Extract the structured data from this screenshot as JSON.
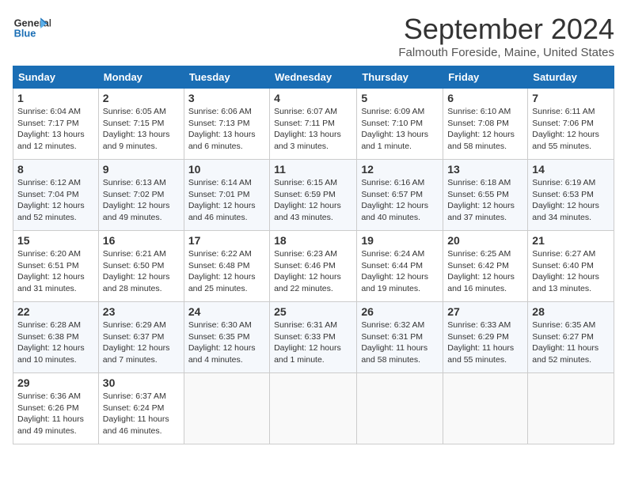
{
  "header": {
    "logo_general": "General",
    "logo_blue": "Blue",
    "month": "September 2024",
    "location": "Falmouth Foreside, Maine, United States"
  },
  "weekdays": [
    "Sunday",
    "Monday",
    "Tuesday",
    "Wednesday",
    "Thursday",
    "Friday",
    "Saturday"
  ],
  "weeks": [
    [
      {
        "day": "1",
        "sunrise": "6:04 AM",
        "sunset": "7:17 PM",
        "daylight": "13 hours and 12 minutes."
      },
      {
        "day": "2",
        "sunrise": "6:05 AM",
        "sunset": "7:15 PM",
        "daylight": "13 hours and 9 minutes."
      },
      {
        "day": "3",
        "sunrise": "6:06 AM",
        "sunset": "7:13 PM",
        "daylight": "13 hours and 6 minutes."
      },
      {
        "day": "4",
        "sunrise": "6:07 AM",
        "sunset": "7:11 PM",
        "daylight": "13 hours and 3 minutes."
      },
      {
        "day": "5",
        "sunrise": "6:09 AM",
        "sunset": "7:10 PM",
        "daylight": "13 hours and 1 minute."
      },
      {
        "day": "6",
        "sunrise": "6:10 AM",
        "sunset": "7:08 PM",
        "daylight": "12 hours and 58 minutes."
      },
      {
        "day": "7",
        "sunrise": "6:11 AM",
        "sunset": "7:06 PM",
        "daylight": "12 hours and 55 minutes."
      }
    ],
    [
      {
        "day": "8",
        "sunrise": "6:12 AM",
        "sunset": "7:04 PM",
        "daylight": "12 hours and 52 minutes."
      },
      {
        "day": "9",
        "sunrise": "6:13 AM",
        "sunset": "7:02 PM",
        "daylight": "12 hours and 49 minutes."
      },
      {
        "day": "10",
        "sunrise": "6:14 AM",
        "sunset": "7:01 PM",
        "daylight": "12 hours and 46 minutes."
      },
      {
        "day": "11",
        "sunrise": "6:15 AM",
        "sunset": "6:59 PM",
        "daylight": "12 hours and 43 minutes."
      },
      {
        "day": "12",
        "sunrise": "6:16 AM",
        "sunset": "6:57 PM",
        "daylight": "12 hours and 40 minutes."
      },
      {
        "day": "13",
        "sunrise": "6:18 AM",
        "sunset": "6:55 PM",
        "daylight": "12 hours and 37 minutes."
      },
      {
        "day": "14",
        "sunrise": "6:19 AM",
        "sunset": "6:53 PM",
        "daylight": "12 hours and 34 minutes."
      }
    ],
    [
      {
        "day": "15",
        "sunrise": "6:20 AM",
        "sunset": "6:51 PM",
        "daylight": "12 hours and 31 minutes."
      },
      {
        "day": "16",
        "sunrise": "6:21 AM",
        "sunset": "6:50 PM",
        "daylight": "12 hours and 28 minutes."
      },
      {
        "day": "17",
        "sunrise": "6:22 AM",
        "sunset": "6:48 PM",
        "daylight": "12 hours and 25 minutes."
      },
      {
        "day": "18",
        "sunrise": "6:23 AM",
        "sunset": "6:46 PM",
        "daylight": "12 hours and 22 minutes."
      },
      {
        "day": "19",
        "sunrise": "6:24 AM",
        "sunset": "6:44 PM",
        "daylight": "12 hours and 19 minutes."
      },
      {
        "day": "20",
        "sunrise": "6:25 AM",
        "sunset": "6:42 PM",
        "daylight": "12 hours and 16 minutes."
      },
      {
        "day": "21",
        "sunrise": "6:27 AM",
        "sunset": "6:40 PM",
        "daylight": "12 hours and 13 minutes."
      }
    ],
    [
      {
        "day": "22",
        "sunrise": "6:28 AM",
        "sunset": "6:38 PM",
        "daylight": "12 hours and 10 minutes."
      },
      {
        "day": "23",
        "sunrise": "6:29 AM",
        "sunset": "6:37 PM",
        "daylight": "12 hours and 7 minutes."
      },
      {
        "day": "24",
        "sunrise": "6:30 AM",
        "sunset": "6:35 PM",
        "daylight": "12 hours and 4 minutes."
      },
      {
        "day": "25",
        "sunrise": "6:31 AM",
        "sunset": "6:33 PM",
        "daylight": "12 hours and 1 minute."
      },
      {
        "day": "26",
        "sunrise": "6:32 AM",
        "sunset": "6:31 PM",
        "daylight": "11 hours and 58 minutes."
      },
      {
        "day": "27",
        "sunrise": "6:33 AM",
        "sunset": "6:29 PM",
        "daylight": "11 hours and 55 minutes."
      },
      {
        "day": "28",
        "sunrise": "6:35 AM",
        "sunset": "6:27 PM",
        "daylight": "11 hours and 52 minutes."
      }
    ],
    [
      {
        "day": "29",
        "sunrise": "6:36 AM",
        "sunset": "6:26 PM",
        "daylight": "11 hours and 49 minutes."
      },
      {
        "day": "30",
        "sunrise": "6:37 AM",
        "sunset": "6:24 PM",
        "daylight": "11 hours and 46 minutes."
      },
      null,
      null,
      null,
      null,
      null
    ]
  ]
}
